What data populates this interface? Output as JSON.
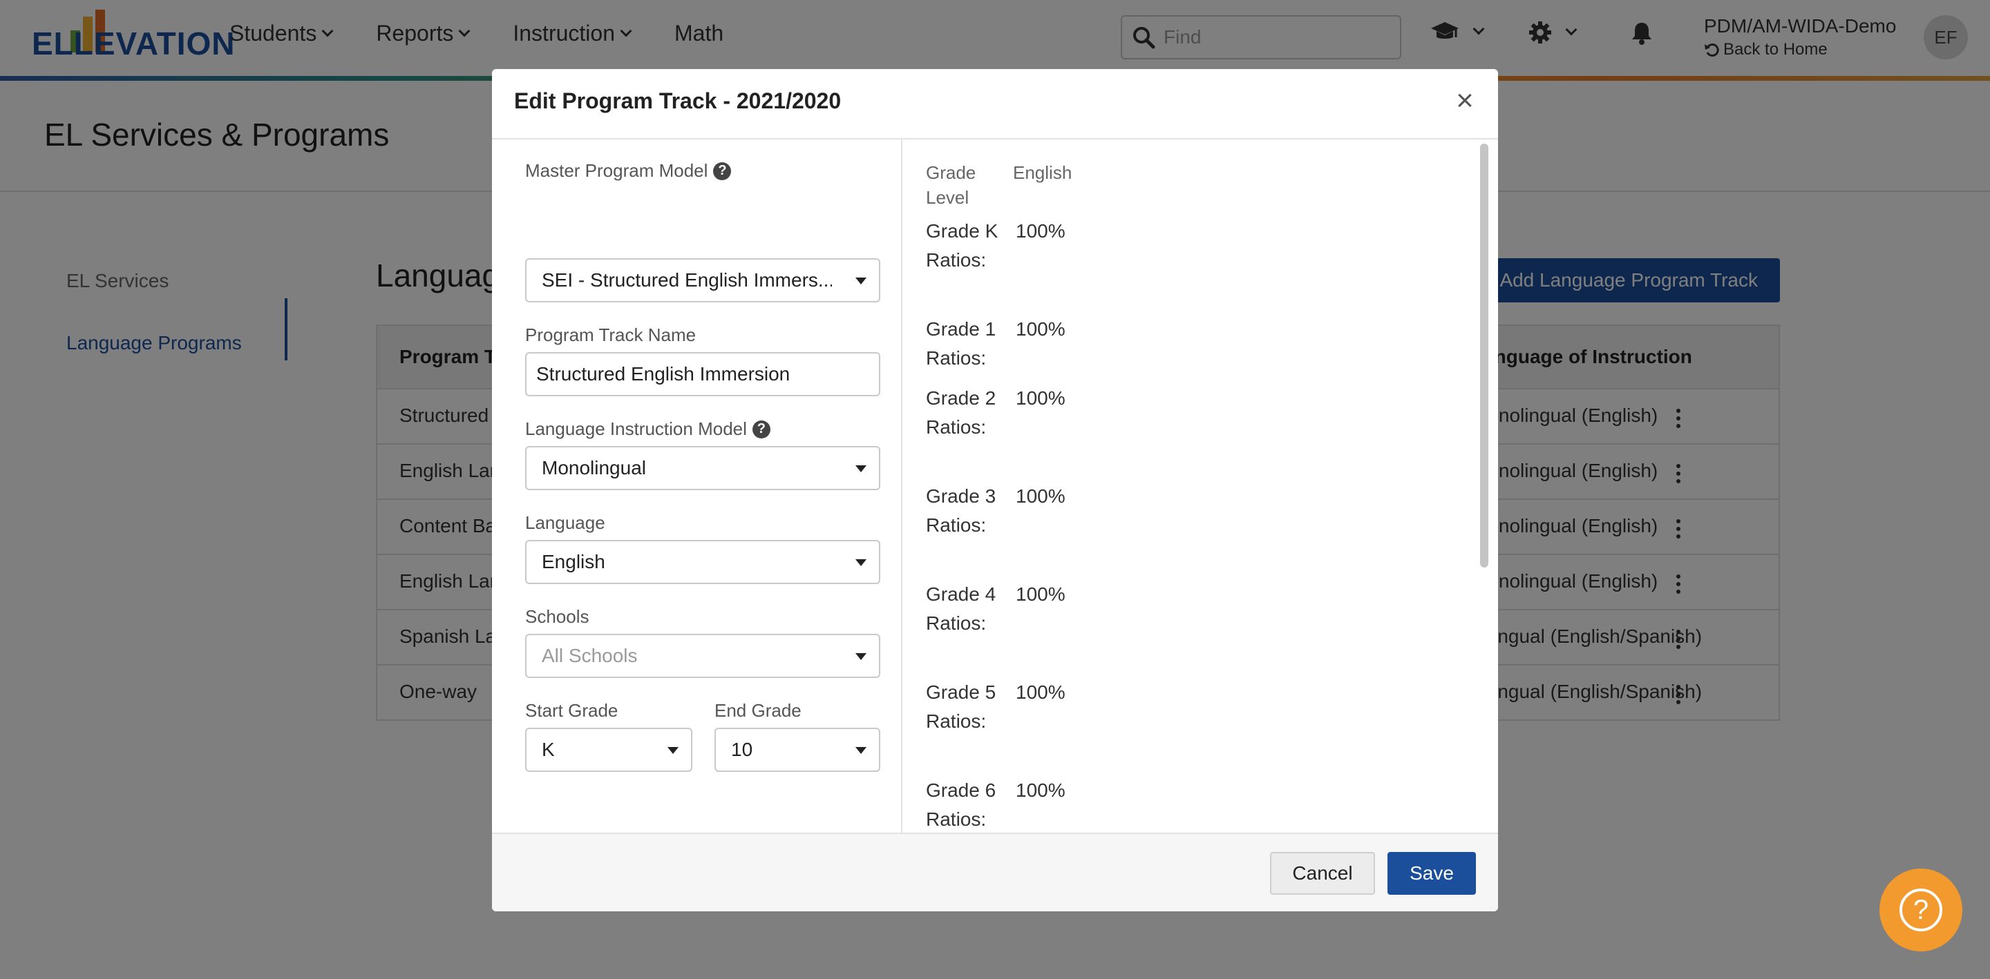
{
  "app": {
    "logo_text": "ELLEVATION",
    "nav": [
      {
        "label": "Students",
        "has_menu": true
      },
      {
        "label": "Reports",
        "has_menu": true
      },
      {
        "label": "Instruction",
        "has_menu": true
      },
      {
        "label": "Math",
        "has_menu": false
      }
    ],
    "search_placeholder": "Find",
    "org_name": "PDM/AM-WIDA-Demo",
    "back_label": "Back to Home",
    "avatar_initials": "EF"
  },
  "page": {
    "title": "EL Services & Programs",
    "sidenav": [
      {
        "label": "EL Services",
        "active": false
      },
      {
        "label": "Language Programs",
        "active": true
      }
    ],
    "section_title": "Language Programs",
    "add_button": "Add Language Program Track",
    "table": {
      "columns": [
        "Program Track",
        "Language of Instruction"
      ],
      "rows": [
        {
          "name": "Structured English Immersion",
          "language": "Monolingual (English)"
        },
        {
          "name": "English Language Development",
          "language": "Monolingual (English)"
        },
        {
          "name": "Content Based ESL",
          "language": "Monolingual (English)"
        },
        {
          "name": "English Language Arts",
          "language": "Monolingual (English)"
        },
        {
          "name": "Spanish Language",
          "language": "Bilingual (English/Spanish)"
        },
        {
          "name": "One-way",
          "language": "Bilingual (English/Spanish)"
        }
      ]
    }
  },
  "modal": {
    "title": "Edit Program Track - 2021/2020",
    "close_symbol": "×",
    "fields": {
      "master_program_model": {
        "label": "Master Program Model",
        "value": "SEI - Structured English Immers..."
      },
      "program_track_name": {
        "label": "Program Track Name",
        "value": "Structured English Immersion"
      },
      "language_instruction_model": {
        "label": "Language Instruction Model",
        "value": "Monolingual"
      },
      "language": {
        "label": "Language",
        "value": "English"
      },
      "schools": {
        "label": "Schools",
        "placeholder": "All Schools"
      },
      "start_grade": {
        "label": "Start Grade",
        "value": "K"
      },
      "end_grade": {
        "label": "End Grade",
        "value": "10"
      }
    },
    "ratios": {
      "header_grade": "Grade Level",
      "header_language": "English",
      "rows": [
        {
          "label": "Grade K Ratios:",
          "value": "100%"
        },
        {
          "label": "Grade 1 Ratios:",
          "value": "100%"
        },
        {
          "label": "Grade 2 Ratios:",
          "value": "100%"
        },
        {
          "label": "Grade 3 Ratios:",
          "value": "100%"
        },
        {
          "label": "Grade 4 Ratios:",
          "value": "100%"
        },
        {
          "label": "Grade 5 Ratios:",
          "value": "100%"
        },
        {
          "label": "Grade 6 Ratios:",
          "value": "100%"
        }
      ]
    },
    "cancel_label": "Cancel",
    "save_label": "Save"
  },
  "help_button_symbol": "?",
  "colors": {
    "brand_blue": "#1b4f9c",
    "help_orange": "#f39a2e"
  }
}
